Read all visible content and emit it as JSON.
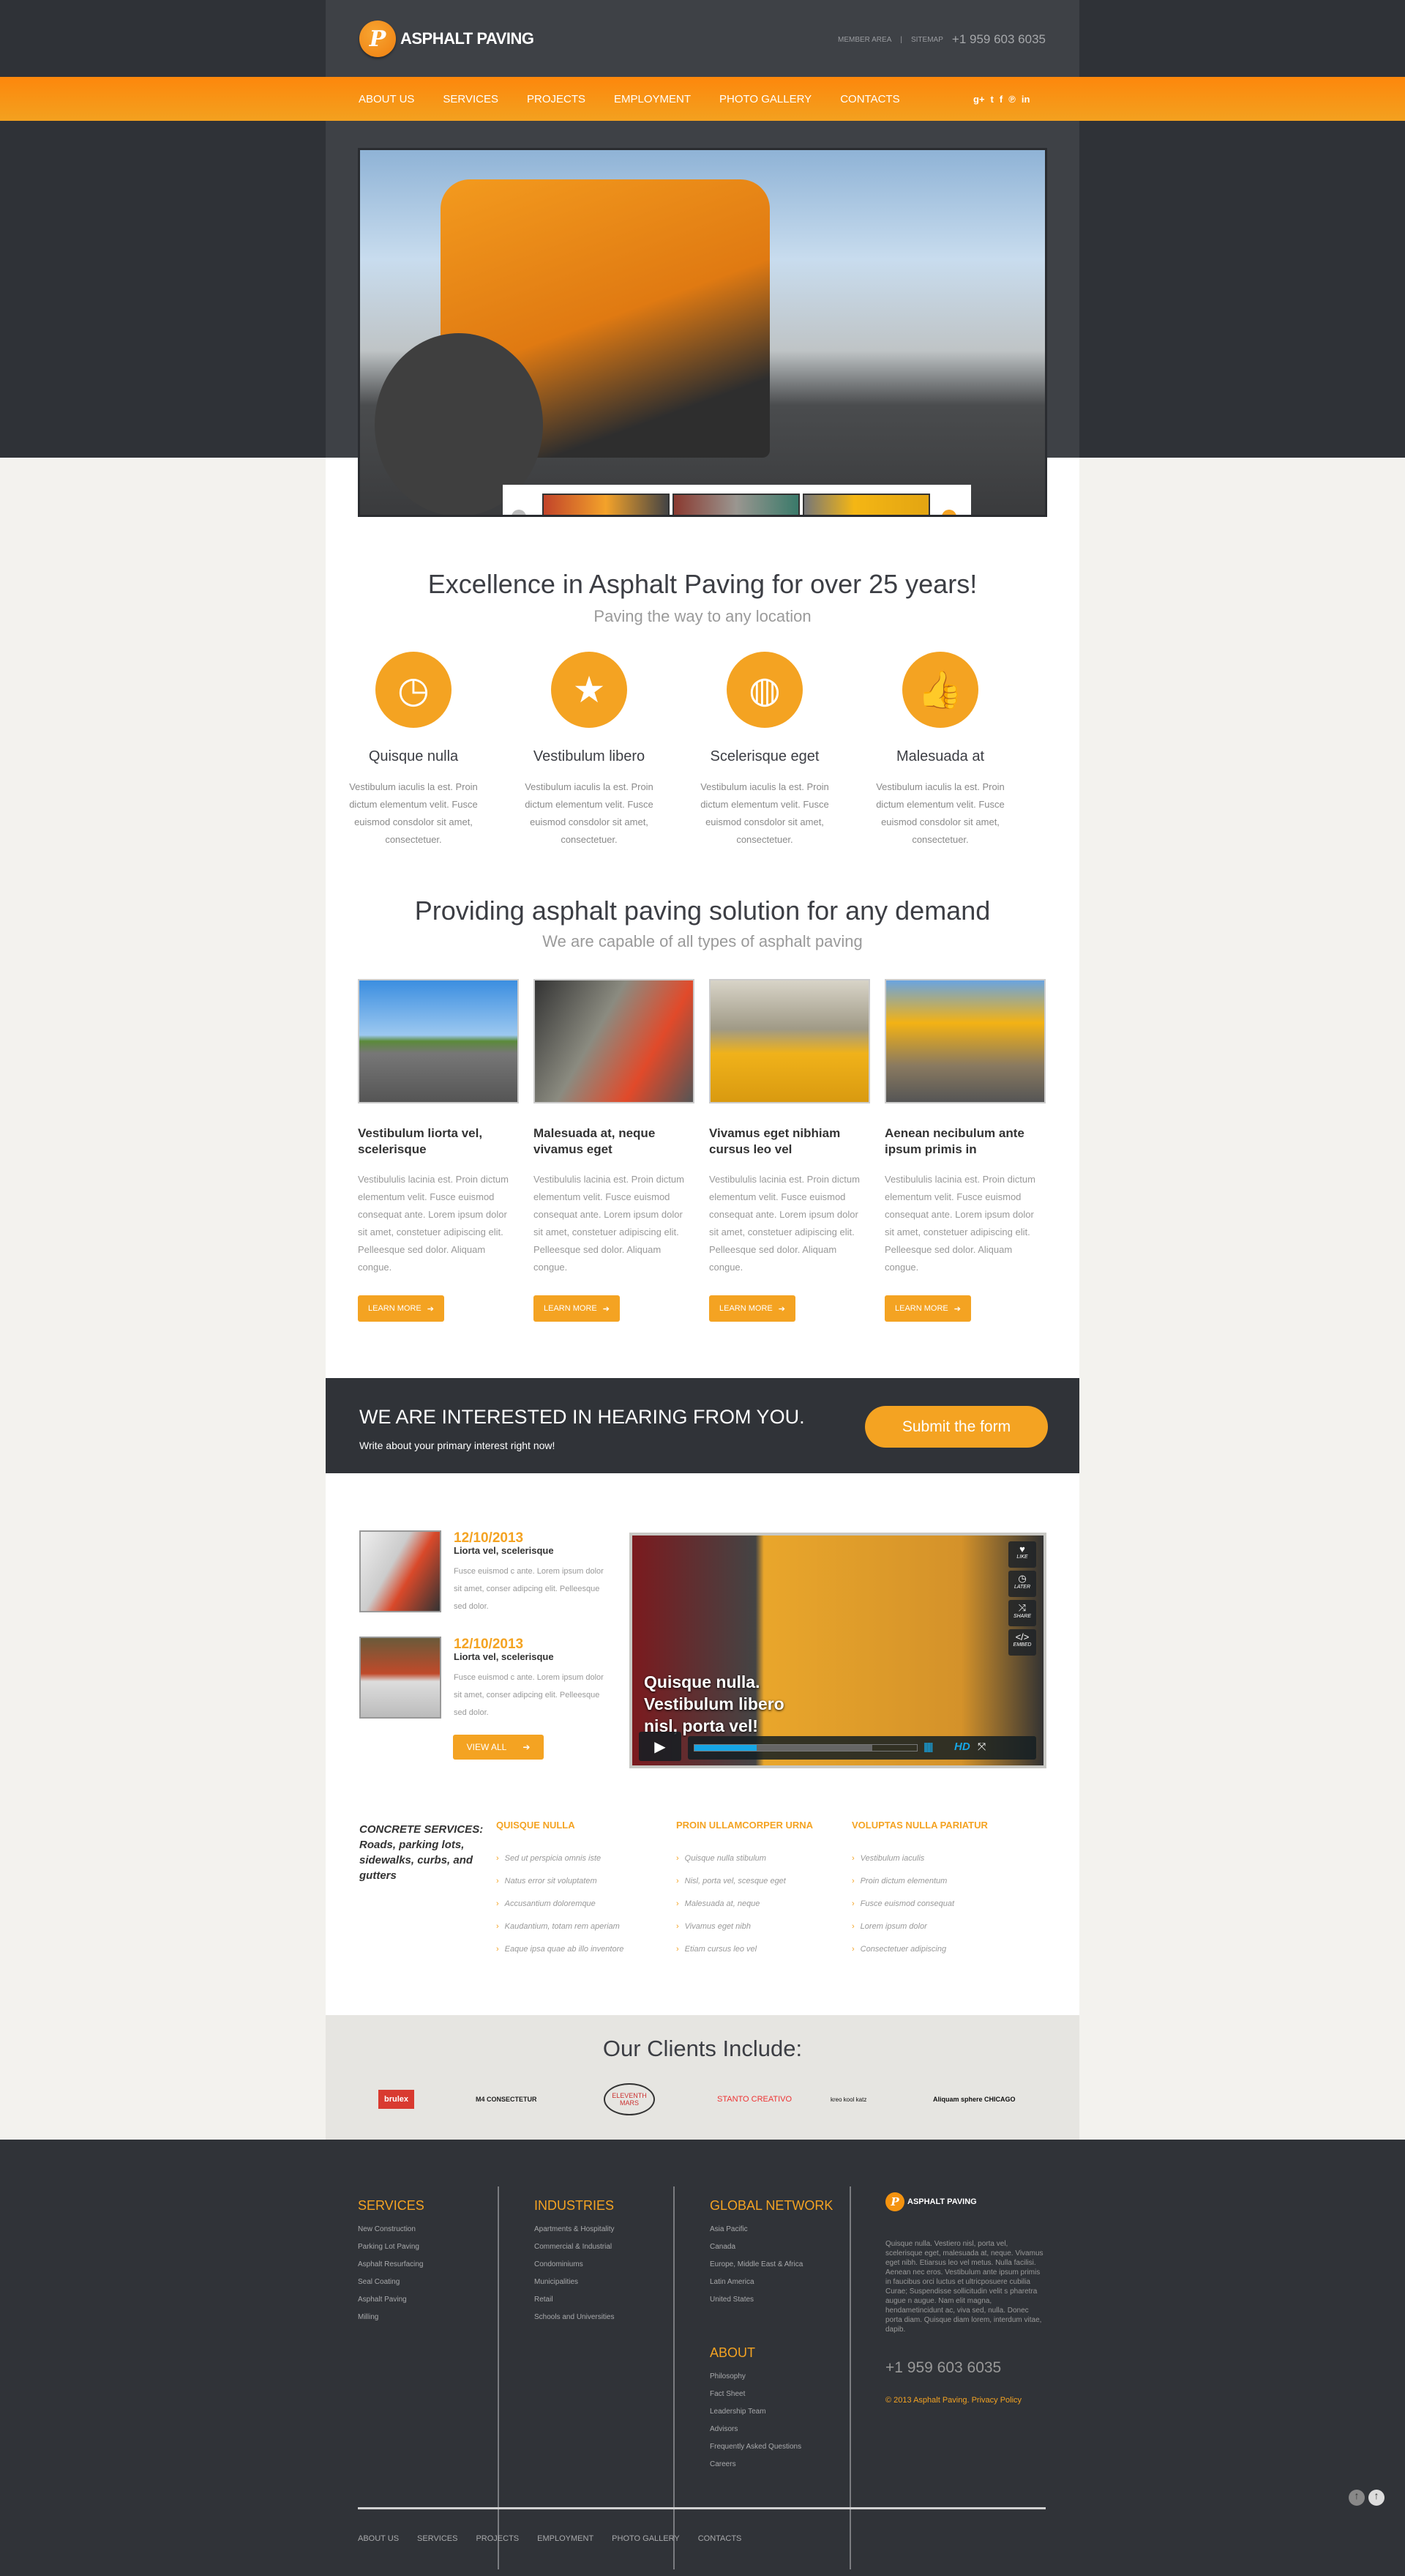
{
  "header": {
    "brand": "ASPHALT PAVING",
    "member_area": "MEMBER AREA",
    "separator": "|",
    "sitemap": "SITEMAP",
    "phone": "+1 959 603 6035"
  },
  "nav": {
    "items": [
      "ABOUT US",
      "SERVICES",
      "PROJECTS",
      "EMPLOYMENT",
      "PHOTO GALLERY",
      "CONTACTS"
    ],
    "social": [
      "google-plus-icon",
      "twitter-icon",
      "facebook-icon",
      "pinterest-icon",
      "linkedin-icon"
    ]
  },
  "colors": {
    "accent": "#f4a322",
    "dark": "#303338",
    "header": "#3e4146"
  },
  "intro": {
    "title": "Excellence in Asphalt Paving for over 25 years!",
    "subtitle": "Paving the way to any location",
    "features": [
      {
        "icon": "clock-icon",
        "title": "Quisque nulla",
        "text": "Vestibulum iaculis la est. Proin dictum elementum velit. Fusce euismod consdolor sit amet, consectetuer."
      },
      {
        "icon": "star-icon",
        "title": "Vestibulum libero",
        "text": "Vestibulum iaculis la est. Proin dictum elementum velit. Fusce euismod consdolor sit amet, consectetuer."
      },
      {
        "icon": "globe-icon",
        "title": "Scelerisque eget",
        "text": "Vestibulum iaculis la est. Proin dictum elementum velit. Fusce euismod consdolor sit amet, consectetuer."
      },
      {
        "icon": "thumbs-up-icon",
        "title": "Malesuada at",
        "text": "Vestibulum iaculis la est. Proin dictum elementum velit. Fusce euismod consdolor sit amet, consectetuer."
      }
    ]
  },
  "services": {
    "title": "Providing asphalt paving solution for any demand",
    "subtitle": "We are capable of all types of asphalt paving",
    "button": "LEARN MORE",
    "items": [
      {
        "title": "Vestibulum liorta vel, scelerisque",
        "text": "Vestibululis lacinia est. Proin dictum elementum velit. Fusce euismod consequat ante. Lorem ipsum dolor sit amet, constetuer adipiscing elit. Pelleesque sed dolor. Aliquam congue."
      },
      {
        "title": "Malesuada at, neque vivamus eget",
        "text": "Vestibululis lacinia est. Proin dictum elementum velit. Fusce euismod consequat ante. Lorem ipsum dolor sit amet, constetuer adipiscing elit. Pelleesque sed dolor. Aliquam congue."
      },
      {
        "title": "Vivamus eget nibhiam cursus leo vel",
        "text": "Vestibululis lacinia est. Proin dictum elementum velit. Fusce euismod consequat ante. Lorem ipsum dolor sit amet, constetuer adipiscing elit. Pelleesque sed dolor. Aliquam congue."
      },
      {
        "title": "Aenean necibulum ante ipsum primis in",
        "text": "Vestibululis lacinia est. Proin dictum elementum velit. Fusce euismod consequat ante. Lorem ipsum dolor sit amet, constetuer adipiscing elit. Pelleesque sed dolor. Aliquam congue."
      }
    ]
  },
  "cta": {
    "title": "WE ARE INTERESTED IN HEARING FROM YOU.",
    "text": "Write about your primary interest right now!",
    "button": "Submit the form"
  },
  "news": {
    "items": [
      {
        "date": "12/10/2013",
        "title": "Liorta vel, scelerisque",
        "text": "Fusce euismod c ante. Lorem ipsum dolor sit amet, conser adipcing elit. Pelleesque sed dolor."
      },
      {
        "date": "12/10/2013",
        "title": "Liorta vel, scelerisque",
        "text": "Fusce euismod c ante. Lorem ipsum dolor sit amet, conser adipcing elit. Pelleesque sed dolor."
      }
    ],
    "view_all": "VIEW ALL"
  },
  "video": {
    "caption": "Quisque nulla. Vestibulum libero nisl, porta vel!",
    "like": "LIKE",
    "later": "LATER",
    "share": "SHARE",
    "embed": "EMBED",
    "hd": "HD",
    "progress": 0.28,
    "buffered": 0.8
  },
  "concrete": {
    "intro": "CONCRETE SERVICES: Roads, parking lots, sidewalks, curbs, and gutters",
    "columns": [
      {
        "title": "QUISQUE NULLA",
        "items": [
          "Sed ut perspicia omnis iste",
          "Natus error sit voluptatem",
          "Accusantium doloremque",
          "Kaudantium, totam rem aperiam",
          "Eaque ipsa quae ab illo inventore"
        ]
      },
      {
        "title": "PROIN ULLAMCORPER URNA",
        "items": [
          "Quisque nulla  stibulum",
          "Nisl, porta vel, scesque eget",
          "Malesuada at, neque",
          "Vivamus eget nibh",
          "Etiam cursus leo vel"
        ]
      },
      {
        "title": "VOLUPTAS NULLA PARIATUR",
        "items": [
          "Vestibulum iaculis",
          "Proin dictum elementum",
          "Fusce euismod consequat",
          "Lorem ipsum dolor",
          "Consectetuer adipiscing"
        ]
      }
    ]
  },
  "clients": {
    "title": "Our Clients Include:",
    "logos": [
      "brulex",
      "M4 CONSECTETUR",
      "ELEVENTH MARS",
      "STANTO CREATIVO",
      "kreo kool katz",
      "Aliquam sphere CHICAGO"
    ]
  },
  "footer": {
    "services": {
      "title": "SERVICES",
      "items": [
        "New Construction",
        "Parking Lot Paving",
        "Asphalt Resurfacing",
        "Seal Coating",
        "Asphalt Paving",
        "Milling"
      ]
    },
    "industries": {
      "title": "INDUSTRIES",
      "items": [
        "Apartments & Hospitality",
        "Commercial & Industrial",
        "Condominiums",
        "Municipalities",
        "Retail",
        "Schools and Universities"
      ]
    },
    "global": {
      "title": "GLOBAL NETWORK",
      "items": [
        "Asia Pacific",
        "Canada",
        "Europe, Middle East & Africa",
        "Latin America",
        "United States"
      ]
    },
    "about": {
      "title": "ABOUT",
      "items": [
        "Philosophy",
        "Fact Sheet",
        "Leadership Team",
        "Advisors",
        "Frequently Asked Questions",
        "Careers"
      ]
    },
    "brand": "ASPHALT PAVING",
    "text": "Quisque nulla. Vestiero nisl, porta vel, scelerisque eget, malesuada at, neque. Vivamus eget nibh. Etiarsus leo vel metus. Nulla facilisi. Aenean nec eros. Vestibulum ante ipsum primis in faucibus orci luctus et ultricposuere cubilia Curae; Suspendisse sollicitudin velit s pharetra augue n augue. Nam elit magna, hendametincidunt ac, viva sed, nulla. Donec porta diam. Quisque diam lorem, interdum vitae, dapib.",
    "phone": "+1 959 603 6035",
    "copyright": "© 2013 Asphalt Paving.",
    "privacy": "Privacy Policy",
    "nav": [
      "ABOUT US",
      "SERVICES",
      "PROJECTS",
      "EMPLOYMENT",
      "PHOTO GALLERY",
      "CONTACTS"
    ]
  }
}
